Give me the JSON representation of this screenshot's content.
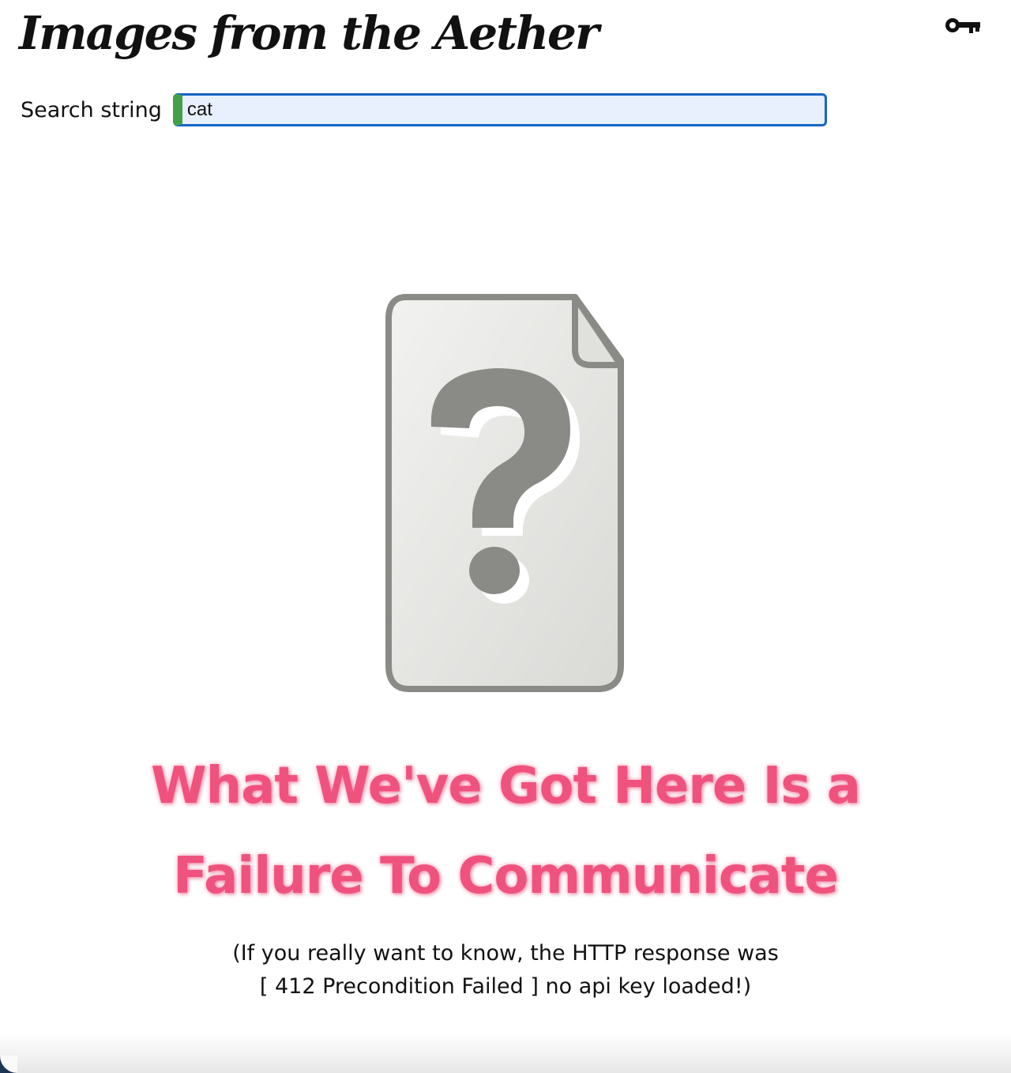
{
  "header": {
    "title": "Images from the Aether",
    "key_icon": "key-icon"
  },
  "search": {
    "label": "Search string",
    "value": "cat"
  },
  "result": {
    "icon": "missing-file-question-icon",
    "headline_line1": "What We've Got Here Is a",
    "headline_line2": "Failure To Communicate",
    "details_line1": "(If you really want to know, the HTTP response was",
    "details_line2": "[ 412 Precondition Failed ] no api key loaded!)"
  },
  "colors": {
    "accent_border": "#1565c0",
    "input_marker": "#43a047",
    "input_background": "#e8f0fe",
    "headline": "#f0527e",
    "icon_gray": "#8a8b87"
  }
}
